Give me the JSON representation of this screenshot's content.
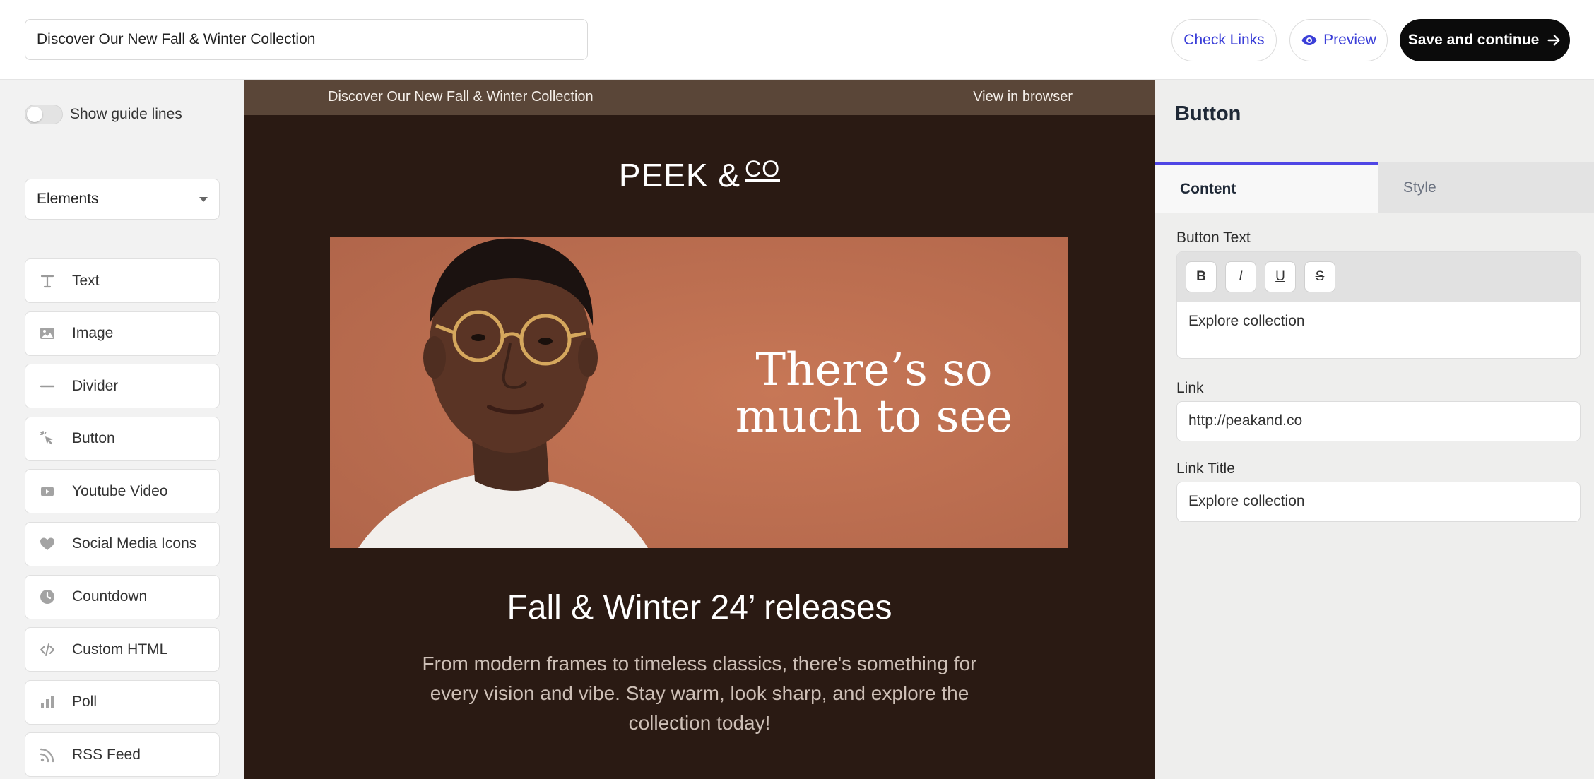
{
  "topbar": {
    "subject_value": "Discover Our New Fall & Winter Collection",
    "check_links_label": "Check Links",
    "preview_label": "Preview",
    "save_label": "Save and continue"
  },
  "sidebar": {
    "guide_lines_label": "Show guide lines",
    "guide_lines_on": false,
    "dropdown_value": "Elements",
    "items": [
      {
        "label": "Text",
        "icon": "text-icon"
      },
      {
        "label": "Image",
        "icon": "image-icon"
      },
      {
        "label": "Divider",
        "icon": "divider-icon"
      },
      {
        "label": "Button",
        "icon": "cursor-click-icon"
      },
      {
        "label": "Youtube Video",
        "icon": "video-icon"
      },
      {
        "label": "Social Media Icons",
        "icon": "heart-icon"
      },
      {
        "label": "Countdown",
        "icon": "clock-icon"
      },
      {
        "label": "Custom HTML",
        "icon": "code-icon"
      },
      {
        "label": "Poll",
        "icon": "bar-chart-icon"
      },
      {
        "label": "RSS Feed",
        "icon": "rss-icon"
      }
    ]
  },
  "email": {
    "preheader_left": "Discover Our New Fall & Winter Collection",
    "preheader_right": "View in browser",
    "brand_main": "PEEK &",
    "brand_super": "CO",
    "hero_headline": "There’s so much to see",
    "section_title": "Fall & Winter 24’ releases",
    "section_body": "From modern frames to timeless classics, there's something for every vision and vibe. Stay warm, look sharp, and explore the collection today!",
    "colors": {
      "background": "#2a1a13",
      "preheader": "#5a4638",
      "hero": "#c07253"
    }
  },
  "panel": {
    "title": "Button",
    "tabs": [
      {
        "label": "Content",
        "active": true
      },
      {
        "label": "Style",
        "active": false
      }
    ],
    "button_text_label": "Button Text",
    "toolbar": {
      "bold": "B",
      "italic": "I",
      "underline": "U",
      "strike": "S"
    },
    "button_text_value": "Explore collection",
    "link_label": "Link",
    "link_value": "http://peakand.co",
    "link_title_label": "Link Title",
    "link_title_value": "Explore collection",
    "accent_color": "#4f46e5"
  }
}
